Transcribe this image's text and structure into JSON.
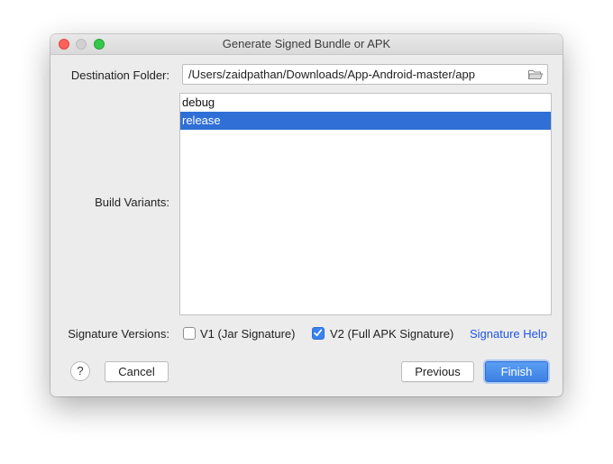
{
  "window": {
    "title": "Generate Signed Bundle or APK"
  },
  "destination": {
    "label": "Destination Folder:",
    "value": "/Users/zaidpathan/Downloads/App-Android-master/app",
    "icon": "folder-icon"
  },
  "build_variants": {
    "label": "Build Variants:",
    "items": [
      {
        "label": "debug",
        "selected": false
      },
      {
        "label": "release",
        "selected": true
      }
    ]
  },
  "signature": {
    "label": "Signature Versions:",
    "v1": {
      "label": "V1 (Jar Signature)",
      "checked": false
    },
    "v2": {
      "label": "V2 (Full APK Signature)",
      "checked": true
    },
    "help_link": "Signature Help"
  },
  "buttons": {
    "help": "?",
    "cancel": "Cancel",
    "previous": "Previous",
    "finish": "Finish"
  },
  "colors": {
    "selection": "#2f6fd6",
    "link": "#2155e6",
    "primary_button": "#3d80e3"
  }
}
